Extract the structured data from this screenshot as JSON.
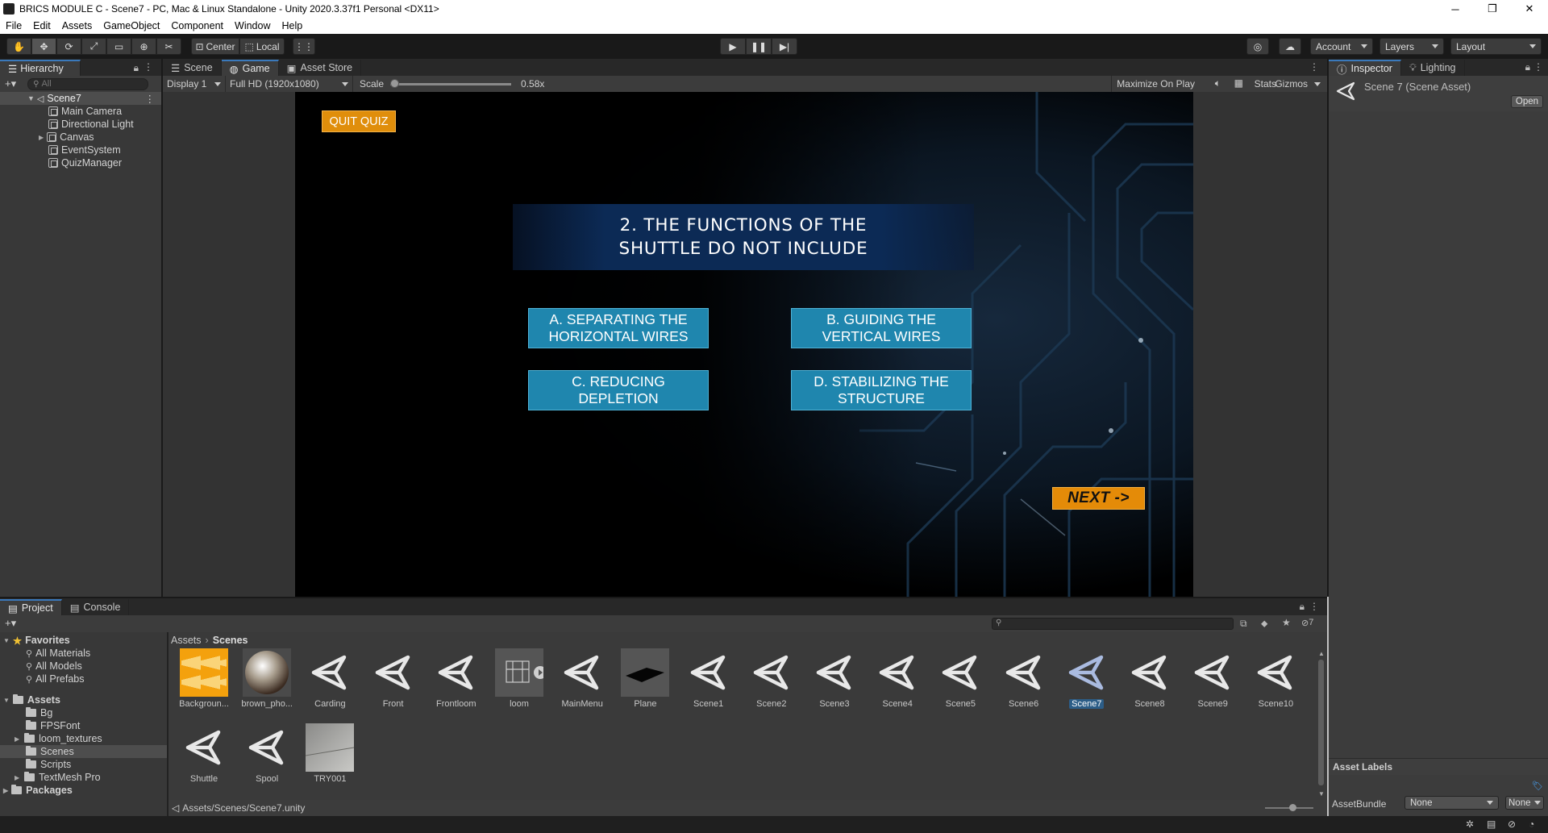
{
  "window": {
    "title": "BRICS MODULE C - Scene7 - PC, Mac & Linux Standalone - Unity 2020.3.37f1 Personal <DX11>",
    "controls": [
      "─",
      "❐",
      "✕"
    ]
  },
  "menu": [
    "File",
    "Edit",
    "Assets",
    "GameObject",
    "Component",
    "Window",
    "Help"
  ],
  "toolbar": {
    "pivot": "Center",
    "space": "Local",
    "account": "Account",
    "layers": "Layers",
    "layout": "Layout"
  },
  "hierarchy": {
    "tab": "Hierarchy",
    "search_placeholder": "All",
    "scene": "Scene7",
    "items": [
      "Main Camera",
      "Directional Light",
      "Canvas",
      "EventSystem",
      "QuizManager"
    ]
  },
  "view_tabs": [
    "Scene",
    "Game",
    "Asset Store"
  ],
  "game_bar": {
    "display": "Display 1",
    "resolution": "Full HD (1920x1080)",
    "scale_label": "Scale",
    "scale_value": "0.58x",
    "scale_level": 0.0,
    "maximize": "Maximize On Play",
    "stats": "Stats",
    "gizmos": "Gizmos"
  },
  "game": {
    "quit": "QUIT QUIZ",
    "question": "2. THE FUNCTIONS OF THE SHUTTLE DO NOT INCLUDE",
    "answers": [
      "A. SEPARATING THE HORIZONTAL WIRES",
      "B. GUIDING THE VERTICAL WIRES",
      "C. REDUCING DEPLETION",
      "D. STABILIZING THE STRUCTURE"
    ],
    "next": "NEXT ->"
  },
  "inspector": {
    "tabs": [
      "Inspector",
      "Lighting"
    ],
    "asset_title": "Scene 7 (Scene Asset)",
    "open_button": "Open",
    "asset_labels": "Asset Labels",
    "asset_bundle_label": "AssetBundle",
    "asset_bundle_value": "None",
    "asset_bundle_variant": "None"
  },
  "project": {
    "tabs": [
      "Project",
      "Console"
    ],
    "hidden_count": "7",
    "favorites_label": "Favorites",
    "favorites": [
      "All Materials",
      "All Models",
      "All Prefabs"
    ],
    "assets_label": "Assets",
    "folders": [
      "Bg",
      "FPSFont",
      "loom_textures",
      "Scenes",
      "Scripts",
      "TextMesh Pro"
    ],
    "packages_label": "Packages",
    "breadcrumb": [
      "Assets",
      "Scenes"
    ],
    "assets": [
      "Backgroun...",
      "brown_pho...",
      "Carding",
      "Front",
      "Frontloom",
      "loom",
      "MainMenu",
      "Plane",
      "Scene1",
      "Scene2",
      "Scene3",
      "Scene4",
      "Scene5",
      "Scene6",
      "Scene7",
      "Scene8",
      "Scene9",
      "Scene10",
      "Shuttle",
      "Spool",
      "TRY001"
    ],
    "selected_asset": "Scene7",
    "path": "Assets/Scenes/Scene7.unity"
  }
}
